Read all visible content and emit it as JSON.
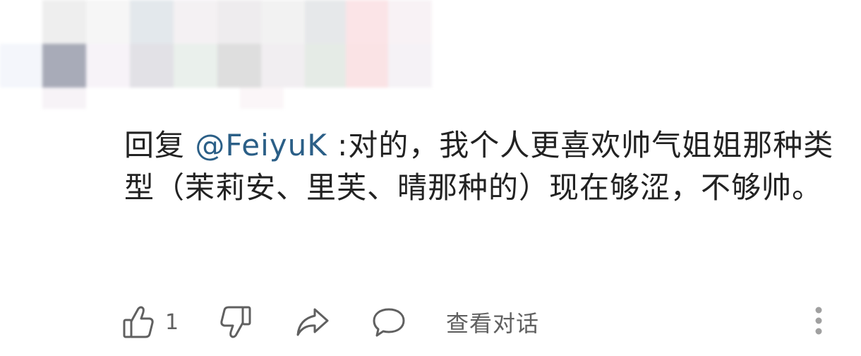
{
  "comment": {
    "reply_prefix": "回复",
    "mention": "@FeiyuK",
    "text": " :对的，我个人更喜欢帅气姐姐那种类型（茉莉安、里芙、晴那种的）现在够涩，不够帅。"
  },
  "actions": {
    "like_count": "1",
    "view_conversation_label": "查看对话"
  },
  "icons": {
    "like": "thumbs-up-icon",
    "dislike": "thumbs-down-icon",
    "share": "share-arrow-icon",
    "reply": "speech-bubble-icon",
    "more": "vertical-dots-icon"
  },
  "colors": {
    "text": "#222222",
    "mention": "#2b5f87",
    "secondary": "#606060"
  }
}
